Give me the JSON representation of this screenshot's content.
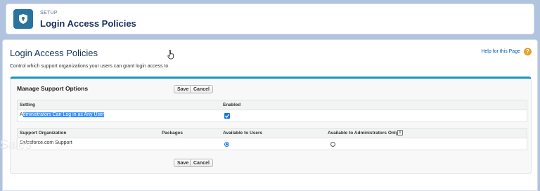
{
  "header": {
    "eyebrow": "SETUP",
    "title": "Login Access Policies",
    "icon": "shield-icon"
  },
  "page": {
    "title": "Login Access Policies",
    "help_link": "Help for this Page",
    "help_icon": "?",
    "description": "Control which support organizations your users can grant login access to."
  },
  "block": {
    "title": "Manage Support Options",
    "buttons": {
      "save": "Save",
      "cancel": "Cancel"
    }
  },
  "settings_table": {
    "headers": [
      "Setting",
      "Enabled"
    ],
    "rows": [
      {
        "setting_prefix": "A",
        "setting_selected": "dministrators Can Log in as Any User",
        "enabled": true
      }
    ]
  },
  "orgs_table": {
    "headers": [
      "Support Organization",
      "Packages",
      "Available to Users",
      "Available to Administrators Only"
    ],
    "info_icon": "i",
    "rows": [
      {
        "organization": "Salesforce.com Support",
        "packages": "",
        "available_to_users": true,
        "available_to_admins_only": false
      }
    ]
  },
  "watermark": "Sales"
}
